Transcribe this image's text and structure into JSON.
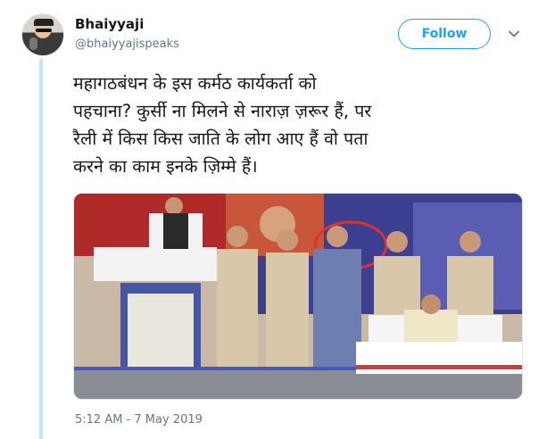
{
  "tweet": {
    "display_name": "Bhaiyyaji",
    "handle": "@bhaiyyajispeaks",
    "follow_label": "Follow",
    "text_lines": [
      "महागठबंधन के इस कर्मठ कार्यकर्ता को",
      "पहचाना? कुर्सी ना मिलने से नाराज़ ज़रूर हैं, पर",
      "रैली में किस किस जाति के लोग आए हैं वो पता",
      "करने का काम इनके ज़िम्मे हैं।"
    ],
    "timestamp": "5:12 AM - 7 May 2019"
  },
  "colors": {
    "accent": "#1da1f2",
    "thread_line": "#c7e6f6",
    "secondary_text": "#657786"
  },
  "icons": {
    "caret": "chevron-down-icon"
  }
}
